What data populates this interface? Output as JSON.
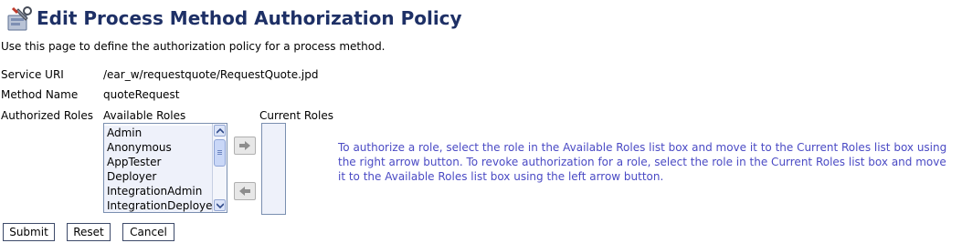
{
  "header": {
    "title": "Edit Process Method Authorization Policy"
  },
  "description": "Use this page to define the authorization policy for a process method.",
  "fields": {
    "service_uri_label": "Service URI",
    "service_uri_value": "/ear_w/requestquote/RequestQuote.jpd",
    "method_name_label": "Method Name",
    "method_name_value": "quoteRequest",
    "authorized_roles_label": "Authorized Roles"
  },
  "roles": {
    "available_label": "Available Roles",
    "current_label": "Current Roles",
    "available": [
      "Admin",
      "Anonymous",
      "AppTester",
      "Deployer",
      "IntegrationAdmin",
      "IntegrationDeployer"
    ]
  },
  "help_text": "To authorize a role, select the role in the Available Roles list box and move it to the Current Roles list box using the right arrow button. To revoke authorization for a role, select the role in the Current Roles list box and move it to the Available Roles list box using the left arrow button.",
  "buttons": {
    "submit": "Submit",
    "reset": "Reset",
    "cancel": "Cancel"
  },
  "colors": {
    "title": "#1e3066",
    "help_text": "#4a4ac4",
    "list_bg": "#eef1fa"
  }
}
